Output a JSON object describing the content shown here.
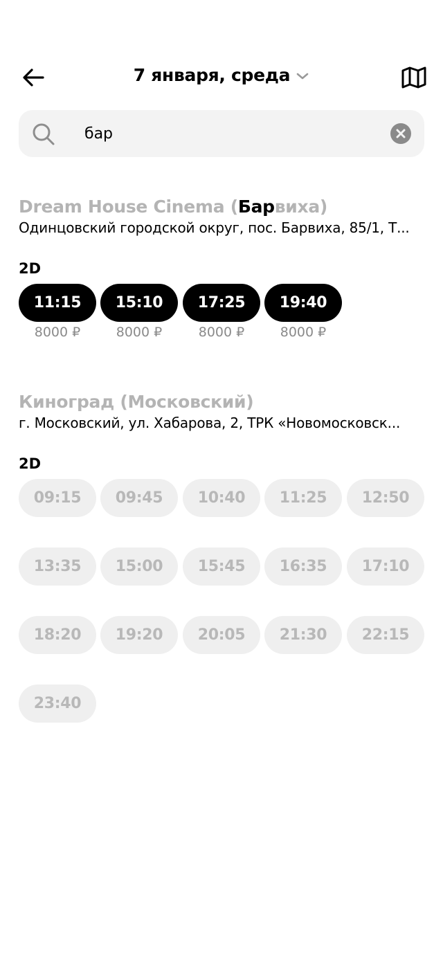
{
  "header": {
    "date_label": "7 января, среда"
  },
  "search": {
    "value": "бар"
  },
  "cinemas": [
    {
      "title_prefix": "Dream House Cinema (",
      "title_highlight": "Бар",
      "title_suffix": "виха)",
      "address": "Одинцовский городской округ, пос. Барвиха, 85/1, Т...",
      "format": "2D",
      "sessions": [
        {
          "time": "11:15",
          "price": "8000 ₽"
        },
        {
          "time": "15:10",
          "price": "8000 ₽"
        },
        {
          "time": "17:25",
          "price": "8000 ₽"
        },
        {
          "time": "19:40",
          "price": "8000 ₽"
        }
      ]
    },
    {
      "title": "Киноград (Московский)",
      "address": "г. Московский, ул. Хабарова, 2, ТРК «Новомосковск...",
      "format": "2D",
      "sessions": [
        {
          "time": "09:15"
        },
        {
          "time": "09:45"
        },
        {
          "time": "10:40"
        },
        {
          "time": "11:25"
        },
        {
          "time": "12:50"
        },
        {
          "time": "13:35"
        },
        {
          "time": "15:00"
        },
        {
          "time": "15:45"
        },
        {
          "time": "16:35"
        },
        {
          "time": "17:10"
        },
        {
          "time": "18:20"
        },
        {
          "time": "19:20"
        },
        {
          "time": "20:05"
        },
        {
          "time": "21:30"
        },
        {
          "time": "22:15"
        },
        {
          "time": "23:40"
        }
      ]
    }
  ]
}
